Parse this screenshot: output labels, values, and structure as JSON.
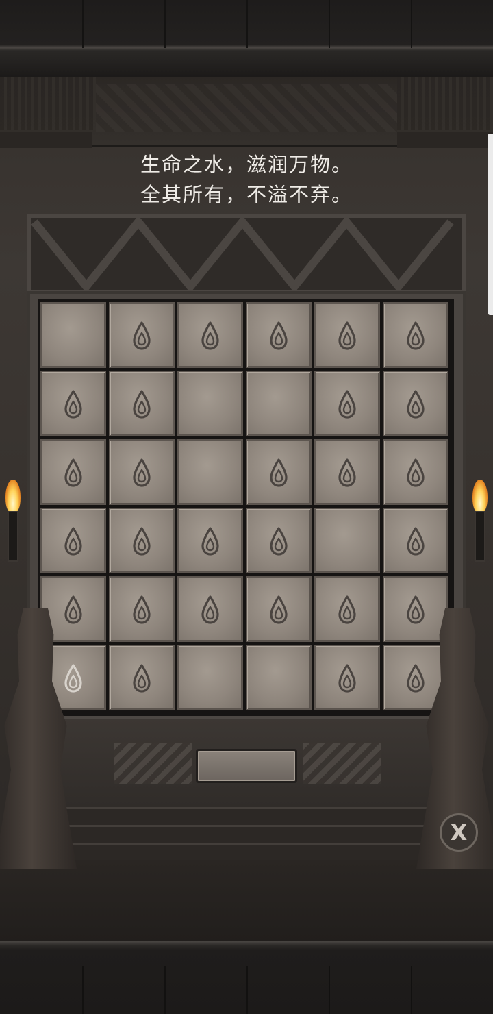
{
  "riddle": {
    "line1": "生命之水，滋润万物。",
    "line2": "全其所有，不溢不弃。"
  },
  "grid": {
    "rows": 6,
    "cols": 6,
    "tiles": [
      [
        0,
        1,
        1,
        1,
        1,
        1
      ],
      [
        1,
        1,
        0,
        0,
        1,
        1
      ],
      [
        1,
        1,
        0,
        1,
        1,
        1
      ],
      [
        1,
        1,
        1,
        1,
        0,
        1
      ],
      [
        1,
        1,
        1,
        1,
        1,
        1
      ],
      [
        2,
        1,
        0,
        0,
        1,
        1
      ]
    ],
    "legend": {
      "0": "blank",
      "1": "water-drop",
      "2": "water-drop-highlighted"
    }
  },
  "controls": {
    "close_label": "X"
  },
  "colors": {
    "tile_stone": "#958c83",
    "drop_icon": "#4a4440",
    "drop_highlight": "#d8d3cc",
    "riddle_text": "#efece7",
    "torch_flame": "#ffd35a"
  }
}
